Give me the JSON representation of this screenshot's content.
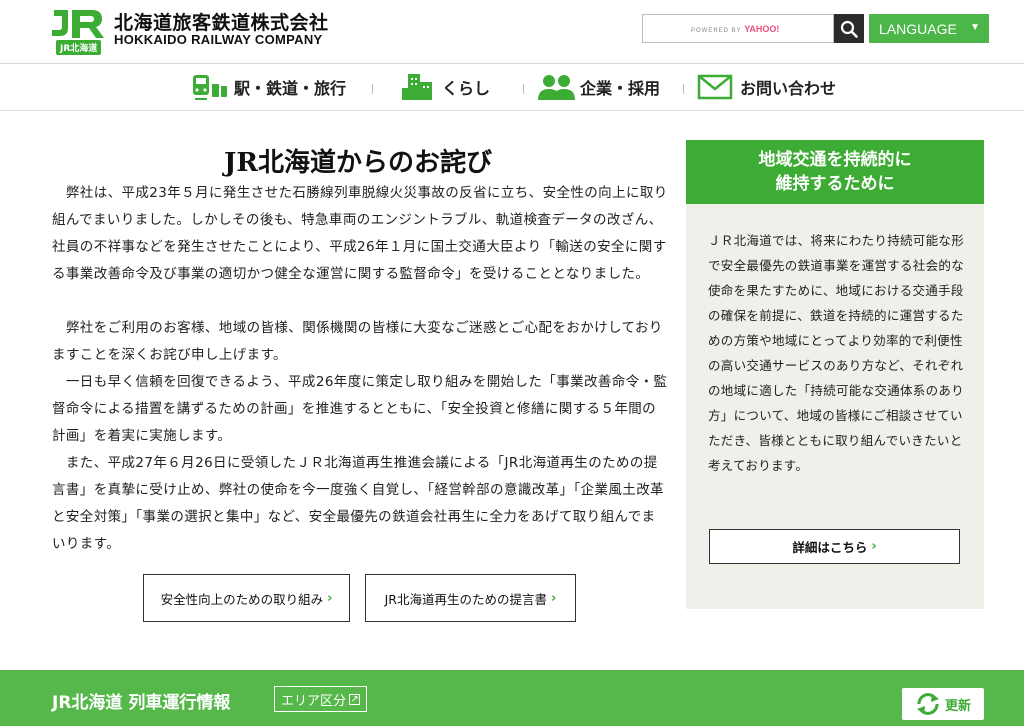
{
  "header": {
    "logo_sub": "JR北海道",
    "company_ja": "北海道旅客鉄道株式会社",
    "company_en": "HOKKAIDO RAILWAY COMPANY",
    "search_placeholder_prefix": "POWERED BY",
    "search_placeholder_brand": "YAHOO!",
    "language_label": "LANGUAGE"
  },
  "nav": {
    "items": [
      {
        "label": "駅・鉄道・旅行"
      },
      {
        "label": "くらし"
      },
      {
        "label": "企業・採用"
      },
      {
        "label": "お問い合わせ"
      }
    ]
  },
  "main": {
    "title": "JR北海道からのお詫び",
    "paragraphs": [
      "　弊社は、平成23年５月に発生させた石勝線列車脱線火災事故の反省に立ち、安全性の向上に取り組んでまいりました。しかしその後も、特急車両のエンジントラブル、軌道検査データの改ざん、社員の不祥事などを発生させたことにより、平成26年１月に国土交通大臣より「輸送の安全に関する事業改善命令及び事業の適切かつ健全な運営に関する監督命令」を受けることとなりました。",
      "　弊社をご利用のお客様、地域の皆様、関係機関の皆様に大変なご迷惑とご心配をおかけしておりますことを深くお詫び申し上げます。",
      "　一日も早く信頼を回復できるよう、平成26年度に策定し取り組みを開始した「事業改善命令・監督命令による措置を講ずるための計画」を推進するとともに、「安全投資と修繕に関する５年間の計画」を着実に実施します。",
      "　また、平成27年６月26日に受領したＪＲ北海道再生推進会議による「JR北海道再生のための提言書」を真摯に受け止め、弊社の使命を今一度強く自覚し、「経営幹部の意識改革」「企業風土改革と安全対策」「事業の選択と集中」など、安全最優先の鉄道会社再生に全力をあげて取り組んでまいります。"
    ],
    "button_safety": "安全性向上のための取り組み",
    "button_proposal": "JR北海道再生のための提言書"
  },
  "sidebar": {
    "title_line1": "地域交通を持続的に",
    "title_line2": "維持するために",
    "body": "ＪＲ北海道では、将来にわたり持続可能な形で安全最優先の鉄道事業を運営する社会的な使命を果たすために、地域における交通手段の確保を前提に、鉄道を持続的に運営するための方策や地域にとってより効率的で利便性の高い交通サービスのあり方など、それぞれの地域に適した「持続可能な交通体系のあり方」について、地域の皆様にご相談させていただき、皆様とともに取り組んでいきたいと考えております。",
    "details_button": "詳細はこちら"
  },
  "band": {
    "title": "JR北海道 列車運行情報",
    "area_button": "エリア区分",
    "refresh_button": "更新"
  },
  "colors": {
    "brand_green": "#3cac35",
    "language_green": "#4cb748",
    "band_green": "#56b84a",
    "sidebar_bg": "#f1efe9"
  },
  "icons": {
    "search": "search-icon",
    "train": "train-icon",
    "building": "building-icon",
    "people": "people-icon",
    "mail": "mail-icon",
    "refresh": "refresh-icon"
  }
}
